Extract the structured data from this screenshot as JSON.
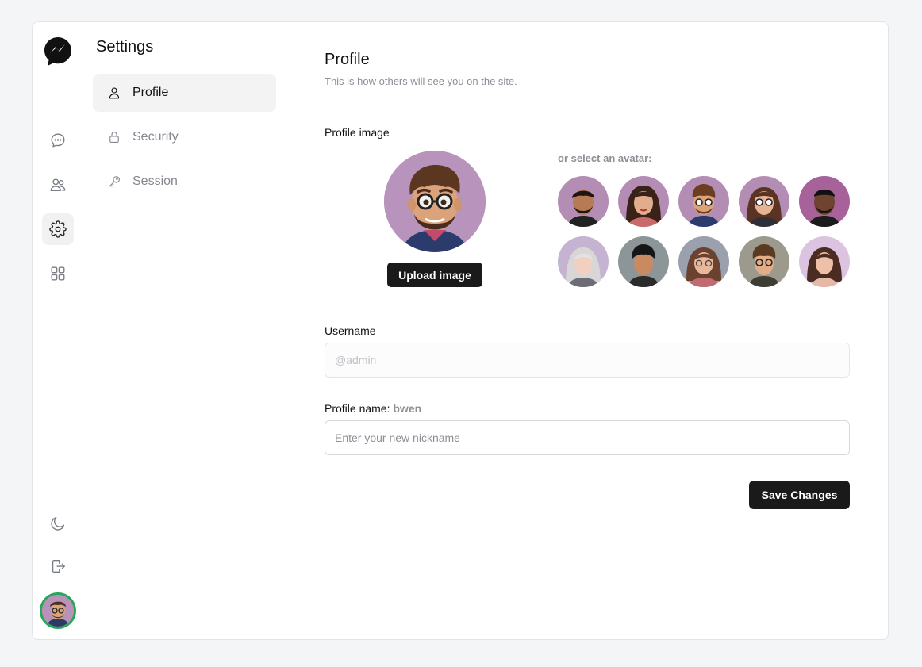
{
  "settings": {
    "title": "Settings",
    "nav": [
      {
        "label": "Profile",
        "icon": "user-icon",
        "active": true
      },
      {
        "label": "Security",
        "icon": "lock-icon",
        "active": false
      },
      {
        "label": "Session",
        "icon": "key-icon",
        "active": false
      }
    ]
  },
  "rail": {
    "items": [
      "chat-icon",
      "users-icon",
      "gear-icon",
      "apps-grid-icon"
    ],
    "active": "gear-icon",
    "bottom": [
      "moon-icon",
      "logout-icon"
    ]
  },
  "profile": {
    "title": "Profile",
    "subtitle": "This is how others will see you on the site.",
    "image_label": "Profile image",
    "upload_label": "Upload image",
    "avatar_hint": "or select an avatar:",
    "username_label": "Username",
    "username_placeholder": "@admin",
    "profile_name_label": "Profile name:",
    "profile_name_current": "bwen",
    "nickname_placeholder": "Enter your new nickname",
    "save_label": "Save Changes"
  },
  "colors": {
    "accent": "#1a1a1a",
    "avatar_bg": "#b893bb",
    "online_ring": "#2aa65a"
  }
}
